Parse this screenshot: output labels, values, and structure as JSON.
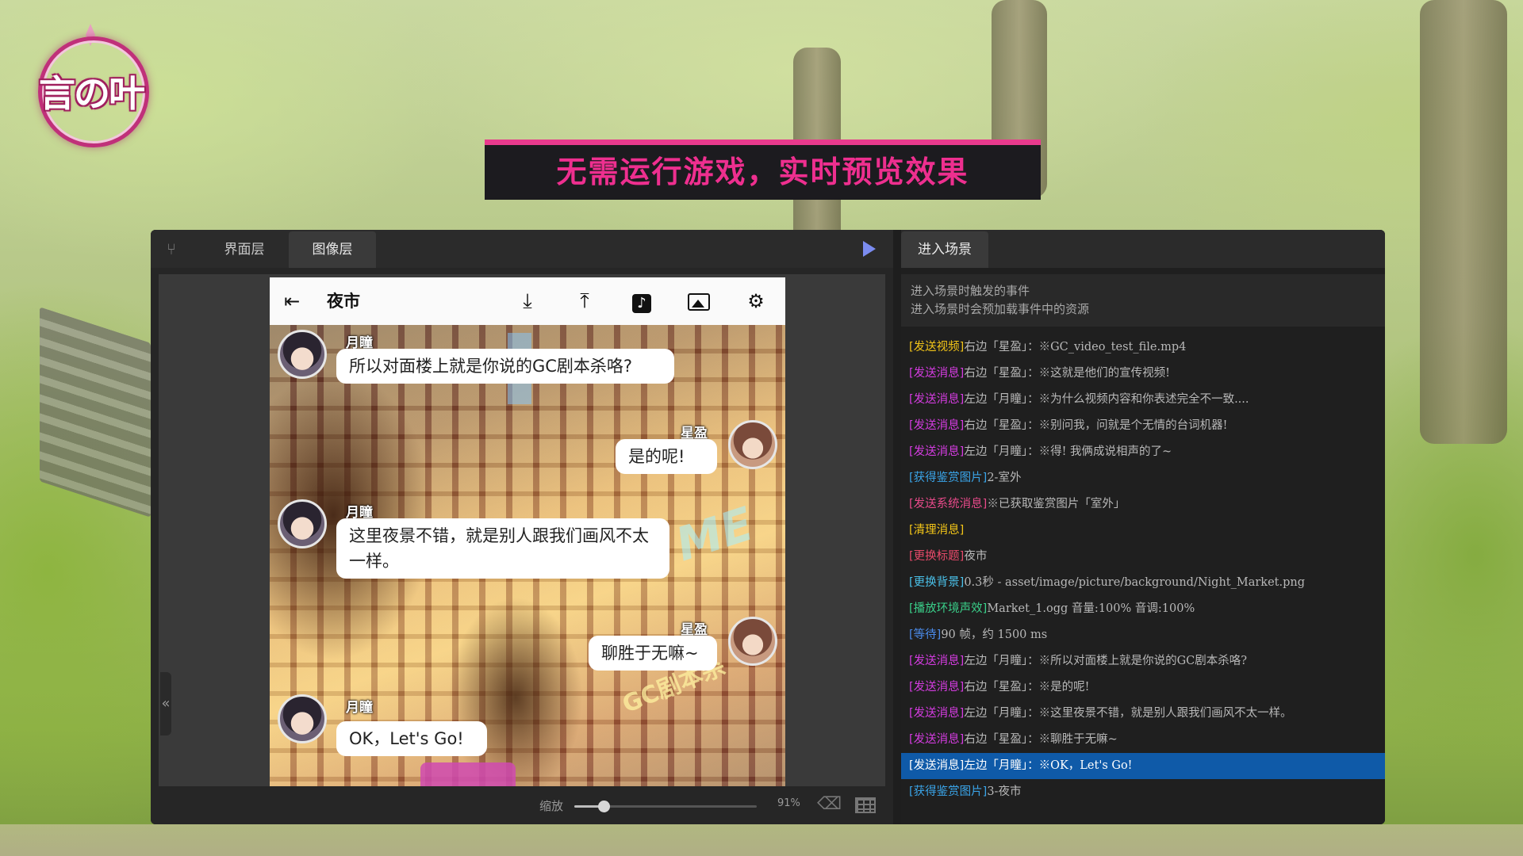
{
  "logo": {
    "text": "言の叶"
  },
  "banner": {
    "text": "无需运行游戏，实时预览效果"
  },
  "editor": {
    "tabs": [
      "界面层",
      "图像层"
    ],
    "active_tab": "图像层",
    "phone": {
      "title": "夜市",
      "messages": [
        {
          "side": "left",
          "speaker": "月瞳",
          "text": "所以对面楼上就是你说的GC剧本杀咯?"
        },
        {
          "side": "right",
          "speaker": "星盈",
          "text": "是的呢!"
        },
        {
          "side": "left",
          "speaker": "月瞳",
          "text": "这里夜景不错，就是别人跟我们画风不太一样。"
        },
        {
          "side": "right",
          "speaker": "星盈",
          "text": "聊胜于无嘛~"
        },
        {
          "side": "left",
          "speaker": "月瞳",
          "text": "OK，Let's Go!"
        }
      ],
      "scene_signs": [
        "ME",
        "GC剧本杀"
      ]
    },
    "zoom": {
      "label": "缩放",
      "value_text": "91%",
      "value": 0.16
    }
  },
  "right": {
    "tab": "进入场景",
    "info": [
      "进入场景时触发的事件",
      "进入场景时会预加载事件中的资源"
    ],
    "events": [
      {
        "tag": "[发送视频]",
        "text": "右边「星盈」：※GC_video_test_file.mp4",
        "color": "#f2c418"
      },
      {
        "tag": "[发送消息]",
        "text": "右边「星盈」：※这就是他们的宣传视频!",
        "color": "#d43ce0"
      },
      {
        "tag": "[发送消息]",
        "text": "左边「月瞳」：※为什么视频内容和你表述完全不一致....",
        "color": "#d43ce0"
      },
      {
        "tag": "[发送消息]",
        "text": "右边「星盈」：※别问我，问就是个无情的台词机器!",
        "color": "#d43ce0"
      },
      {
        "tag": "[发送消息]",
        "text": "左边「月瞳」：※得! 我俩成说相声的了~",
        "color": "#d43ce0"
      },
      {
        "tag": "[获得鉴赏图片]",
        "text": "2-室外",
        "color": "#3aa4e8"
      },
      {
        "tag": "[发送系统消息]",
        "text": "※已获取鉴赏图片「室外」",
        "color": "#e84a8a"
      },
      {
        "tag": "[清理消息]",
        "text": "",
        "color": "#f2c418"
      },
      {
        "tag": "[更换标题]",
        "text": "夜市",
        "color": "#e84a6a"
      },
      {
        "tag": "[更换背景]",
        "text": "0.3秒 - asset/image/picture/background/Night_Market.png",
        "color": "#4ac0e8"
      },
      {
        "tag": "[播放环境声效]",
        "text": "Market_1.ogg 音量:100% 音调:100%",
        "color": "#3ad08a"
      },
      {
        "tag": "[等待]",
        "text": "90 帧，约 1500 ms",
        "color": "#4a8ae8"
      },
      {
        "tag": "[发送消息]",
        "text": "左边「月瞳」：※所以对面楼上就是你说的GC剧本杀咯?",
        "color": "#d43ce0"
      },
      {
        "tag": "[发送消息]",
        "text": "右边「星盈」：※是的呢!",
        "color": "#d43ce0"
      },
      {
        "tag": "[发送消息]",
        "text": "左边「月瞳」：※这里夜景不错，就是别人跟我们画风不太一样。",
        "color": "#d43ce0"
      },
      {
        "tag": "[发送消息]",
        "text": "右边「星盈」：※聊胜于无嘛~",
        "color": "#d43ce0"
      },
      {
        "tag": "[发送消息]",
        "text": "左边「月瞳」：※OK，Let's Go!",
        "color": "#ffffff",
        "selected": true
      },
      {
        "tag": "[获得鉴赏图片]",
        "text": "3-夜市",
        "color": "#3aa4e8"
      }
    ]
  }
}
